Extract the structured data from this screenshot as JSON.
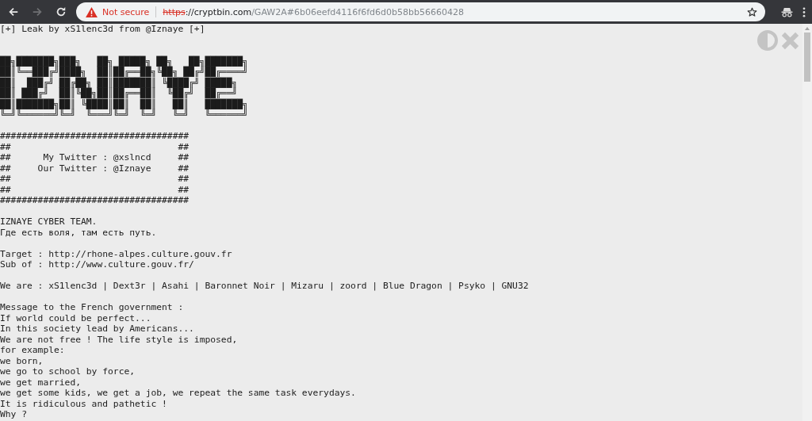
{
  "toolbar": {
    "nav_buttons": [
      {
        "kind": "back",
        "disabled": false
      },
      {
        "kind": "forward",
        "disabled": true
      },
      {
        "kind": "reload",
        "disabled": false
      }
    ],
    "address": {
      "security_label": "Not secure",
      "scheme": "https",
      "host": "://cryptbin.com",
      "path": "/GAW2A#6b06eefd4116f6fd6d0b58bb56660428"
    }
  },
  "blocks": [
    {
      "kind": "text",
      "lines": [
        "[+] Leak by xS1lenc3d from @Iznaye [+]"
      ]
    },
    {
      "kind": "banner",
      "lines": [
        "██╗███████╗███╗   ██╗ █████╗ ██╗   ██╗███████╗",
        "██║╚══███╔╝████╗  ██║██╔══██╗╚██╗ ██╔╝██╔════╝",
        "██║  ███╔╝ ██╔██╗ ██║███████║ ╚████╔╝ █████╗  ",
        "██║ ███╔╝  ██║╚██╗██║██╔══██║  ╚██╔╝  ██╔══╝  ",
        "██║███████╗██║ ╚████║██║  ██║   ██║   ███████╗",
        "╚═╝╚══════╝╚═╝  ╚═══╝╚═╝  ╚═╝   ╚═╝   ╚══════╝"
      ]
    },
    {
      "kind": "text",
      "lines": [
        "###################################",
        "##                               ##",
        "##      My Twitter : @xslncd     ##",
        "##     Our Twitter : @Iznaye     ##",
        "##                               ##",
        "##                               ##",
        "###################################"
      ]
    },
    {
      "kind": "text",
      "lines": [
        "IZNAYE CYBER TEAM.",
        "Где есть воля, там есть путь."
      ]
    },
    {
      "kind": "text",
      "lines": [
        "Target : http://rhone-alpes.culture.gouv.fr",
        "Sub of : http://www.culture.gouv.fr/"
      ]
    },
    {
      "kind": "text",
      "lines": [
        "We are : xS1lenc3d | Dext3r | Asahi | Baronnet Noir | Mizaru | zoord | Blue Dragon | Psyko | GNU32"
      ]
    },
    {
      "kind": "text",
      "lines": [
        "Message to the French government :",
        "If world could be perfect...",
        "In this society lead by Americans...",
        "We are not free ! The life style is imposed,",
        "for example:",
        "we born,",
        "we go to school by force,",
        "we get married,",
        "we get some kids, we get a job, we repeat the same task everydays.",
        "It is ridiculous and pathetic !",
        "Why ?"
      ]
    }
  ]
}
